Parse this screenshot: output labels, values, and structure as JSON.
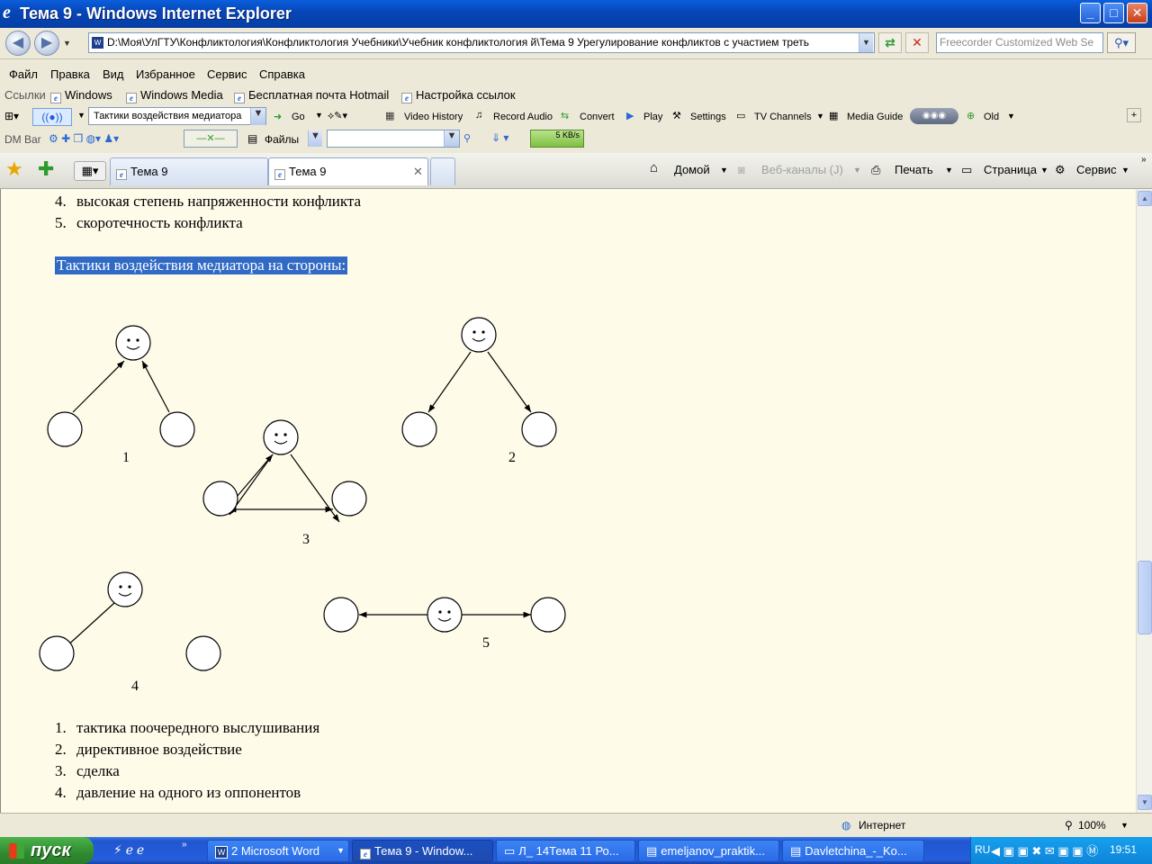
{
  "window": {
    "title": "Тема 9 - Windows Internet Explorer",
    "minimize": "_",
    "maximize": "□",
    "close": "✕"
  },
  "address": {
    "url": "D:\\Моя\\УлГТУ\\Конфликтология\\Конфликтология Учебники\\Учебник конфликтология й\\Тема 9 Урегулирование конфликтов с участием треть",
    "search_placeholder": "Freecorder Customized Web Se"
  },
  "menu": [
    "Файл",
    "Правка",
    "Вид",
    "Избранное",
    "Сервис",
    "Справка"
  ],
  "links": {
    "label": "Ссылки",
    "items": [
      "Windows",
      "Windows Media",
      "Бесплатная почта Hotmail",
      "Настройка ссылок"
    ]
  },
  "toolbar1": {
    "search_value": "Тактики воздействия медиатора",
    "go": "Go",
    "video_history": "Video History",
    "record_audio": "Record Audio",
    "convert": "Convert",
    "play": "Play",
    "settings": "Settings",
    "tv_channels": "TV Channels",
    "media_guide": "Media Guide",
    "old": "Old"
  },
  "toolbar2": {
    "dm_bar": "DM Bar",
    "files": "Файлы",
    "speed": "5 KB/s"
  },
  "tabs": [
    {
      "label": "Тема 9"
    },
    {
      "label": "Тема 9"
    }
  ],
  "commands": {
    "home": "Домой",
    "feeds": "Веб-каналы (J)",
    "print": "Печать",
    "page": "Страница",
    "tools": "Сервис"
  },
  "content": {
    "list_top": [
      {
        "n": "4.",
        "text": "высокая степень напряженности конфликта"
      },
      {
        "n": "5.",
        "text": "скоротечность конфликта"
      }
    ],
    "heading": "Тактики воздействия медиатора на стороны:",
    "figure_labels": [
      "1",
      "2",
      "3",
      "4",
      "5"
    ],
    "list_bottom": [
      {
        "n": "1.",
        "text": "тактика поочередного выслушивания"
      },
      {
        "n": "2.",
        "text": "директивное воздействие"
      },
      {
        "n": "3.",
        "text": "сделка"
      },
      {
        "n": "4.",
        "text": "давление на одного из оппонентов"
      }
    ]
  },
  "status": {
    "zone": "Интернет",
    "zoom": "100%"
  },
  "taskbar": {
    "start": "пуск",
    "tasks": [
      "2 Microsoft Word",
      "Тема 9 - Window...",
      "Л_ 14Тема 11 Ро...",
      "emeljanov_praktik...",
      "Davletchina_-_Ko..."
    ],
    "lang": "RU",
    "clock": "19:51"
  }
}
